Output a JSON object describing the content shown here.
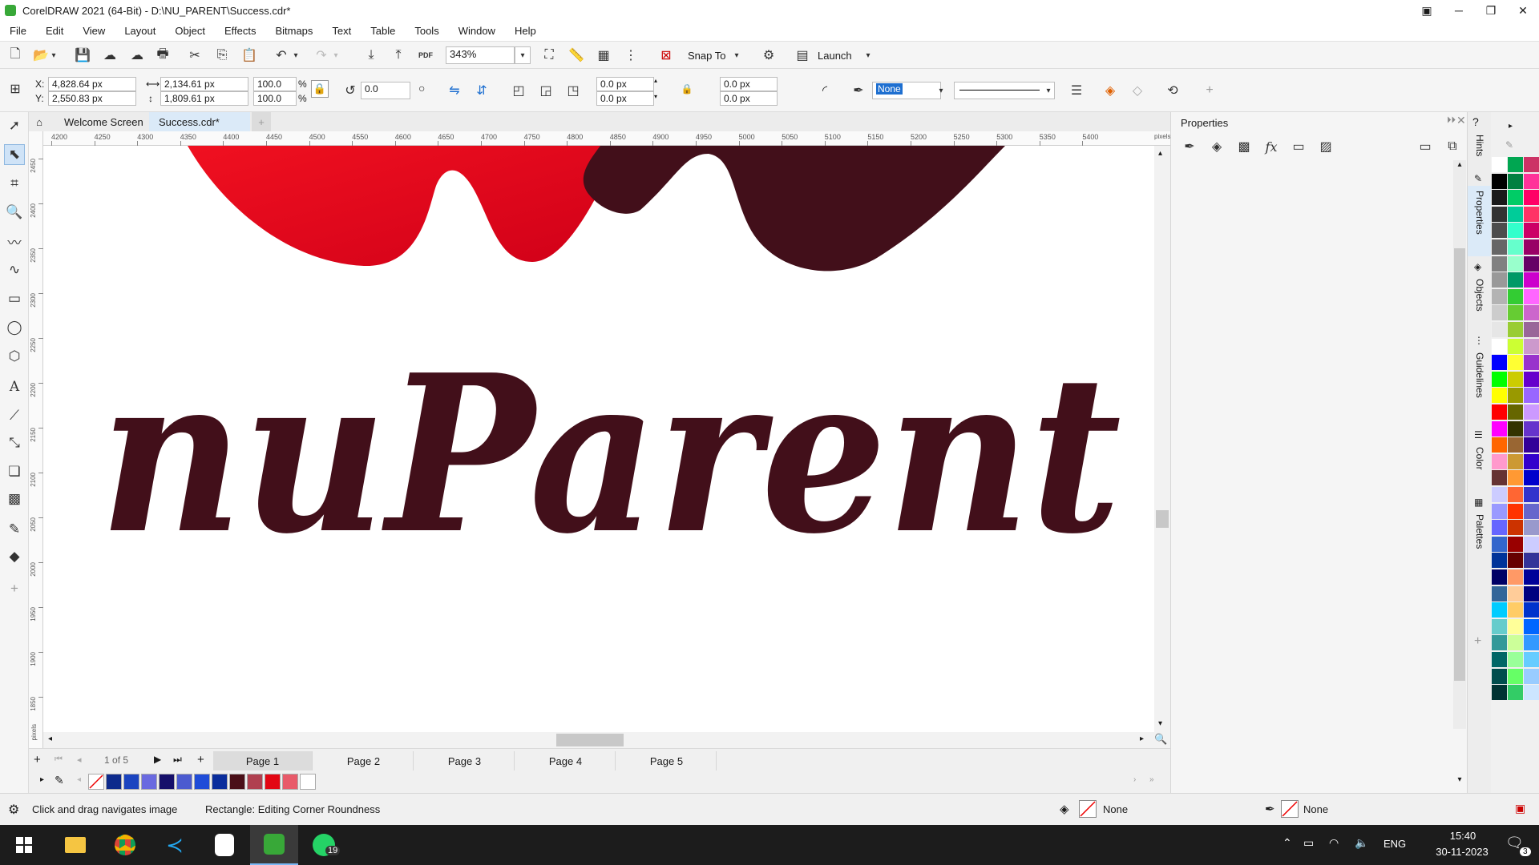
{
  "window": {
    "title": "CorelDRAW 2021 (64-Bit) - D:\\NU_PARENT\\Success.cdr*"
  },
  "menu": [
    "File",
    "Edit",
    "View",
    "Layout",
    "Object",
    "Effects",
    "Bitmaps",
    "Text",
    "Table",
    "Tools",
    "Window",
    "Help"
  ],
  "toolbar": {
    "pdf_label": "PDF",
    "zoom_value": "343%",
    "snap_to_label": "Snap To",
    "launch_label": "Launch"
  },
  "property_bar": {
    "x_label": "X:",
    "x_value": "4,828.64 px",
    "y_label": "Y:",
    "y_value": "2,550.83 px",
    "width_value": "2,134.61 px",
    "height_value": "1,809.61 px",
    "scale_w": "100.0",
    "scale_h": "100.0",
    "pct1": "%",
    "pct2": "%",
    "rotation_value": "0.0",
    "corner_tl": "0.0 px",
    "corner_bl": "0.0 px",
    "corner_tr": "0.0 px",
    "corner_br": "0.0 px",
    "outline_width": "None"
  },
  "doc_tabs": {
    "welcome": "Welcome Screen",
    "active": "Success.cdr*"
  },
  "ruler": {
    "ticks": [
      "4200",
      "4250",
      "4300",
      "4350",
      "4400",
      "4450",
      "4500",
      "4550",
      "4600",
      "4650",
      "4700",
      "4750",
      "4800",
      "4850",
      "4900",
      "4950",
      "5000",
      "5050",
      "5100",
      "5150",
      "5200",
      "5250",
      "5300",
      "5350",
      "5400"
    ],
    "units": "pixels",
    "vticks": [
      "2450",
      "2400",
      "2350",
      "2300",
      "2250",
      "2200",
      "2150",
      "2100",
      "2050",
      "2000",
      "1950",
      "1900",
      "1850"
    ],
    "vunits": "pixels"
  },
  "canvas": {
    "logo_text": "nuParent",
    "logo_color": "#420f1a",
    "accent_red": "#e30613"
  },
  "page_nav": {
    "counter_current": "1",
    "counter_of": "of",
    "counter_total": "5",
    "pages": [
      "Page 1",
      "Page 2",
      "Page 3",
      "Page 4",
      "Page 5"
    ]
  },
  "doc_palette_colors": [
    "#0d2a8c",
    "#1a44c0",
    "#6a6ae0",
    "#16106a",
    "#4b5bd0",
    "#1f4cd8",
    "#0a2d9c",
    "#4a0f18",
    "#b04050",
    "#e30613",
    "#e85a6a",
    "#ffffff"
  ],
  "docker": {
    "title": "Properties"
  },
  "docker_tabs": [
    "Hints",
    "Properties",
    "Objects",
    "Guidelines",
    "Color",
    "Palettes"
  ],
  "color_palette": [
    [
      "#ffffff",
      "#000000",
      "#1a1a1a",
      "#333333",
      "#4d4d4d",
      "#666666",
      "#808080",
      "#999999",
      "#b3b3b3",
      "#cccccc",
      "#e6e6e6",
      "#ffffff",
      "#0000ff",
      "#00ff00",
      "#ffff00",
      "#ff0000",
      "#ff00ff",
      "#ff6600",
      "#ff99cc",
      "#663333",
      "#ccccff",
      "#9999ff",
      "#6666ff",
      "#3366cc",
      "#003399",
      "#000066",
      "#336699",
      "#00ccff",
      "#66cccc",
      "#339999",
      "#006666",
      "#004d4d",
      "#003333"
    ],
    [
      "#00a651",
      "#008040",
      "#00cc66",
      "#00cc99",
      "#33ffcc",
      "#66ffcc",
      "#99ffcc",
      "#009966",
      "#33cc33",
      "#66cc33",
      "#99cc33",
      "#ccff33",
      "#ffff33",
      "#cccc00",
      "#999900",
      "#666600",
      "#333300",
      "#996633",
      "#cc9933",
      "#ff9933",
      "#ff6633",
      "#ff3300",
      "#cc3300",
      "#990000",
      "#660000",
      "#ff9966",
      "#ffcc99",
      "#ffcc66",
      "#ffff99",
      "#ccff99",
      "#99ff99",
      "#66ff66",
      "#33cc66"
    ],
    [
      "#cc3366",
      "#ff3399",
      "#ff0066",
      "#ff3366",
      "#cc0066",
      "#990066",
      "#660066",
      "#cc00cc",
      "#ff66ff",
      "#cc66cc",
      "#996699",
      "#cc99cc",
      "#9933cc",
      "#6600cc",
      "#9966ff",
      "#cc99ff",
      "#6633cc",
      "#330099",
      "#3300cc",
      "#0000cc",
      "#3333cc",
      "#6666cc",
      "#9999cc",
      "#ccccff",
      "#333399",
      "#000099",
      "#000080",
      "#0033cc",
      "#0066ff",
      "#3399ff",
      "#66ccff",
      "#99ccff",
      "#cce5ff"
    ]
  ],
  "status": {
    "hint": "Click and drag navigates image",
    "selection": "Rectangle: Editing Corner Roundness",
    "fill_label": "None",
    "outline_label": "None"
  },
  "taskbar": {
    "whatsapp_badge": "19",
    "lang": "ENG",
    "time": "15:40",
    "date": "30-11-2023",
    "notif_count": "3"
  }
}
